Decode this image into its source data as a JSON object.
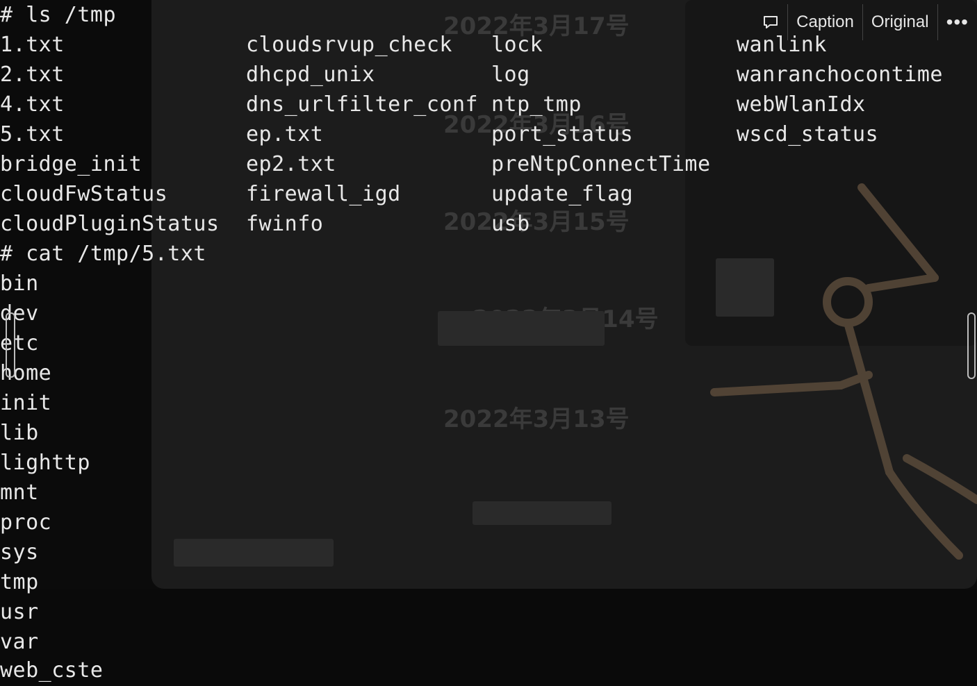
{
  "terminal": {
    "cmd1": "# ls /tmp",
    "ls_columns": [
      [
        "1.txt",
        "2.txt",
        "4.txt",
        "5.txt",
        "bridge_init",
        "cloudFwStatus",
        "cloudPluginStatus"
      ],
      [
        "cloudsrvup_check",
        "dhcpd_unix",
        "dns_urlfilter_conf",
        "ep.txt",
        "ep2.txt",
        "firewall_igd",
        "fwinfo"
      ],
      [
        "lock",
        "log",
        "ntp_tmp",
        "port_status",
        "preNtpConnectTime",
        "update_flag",
        "usb"
      ],
      [
        "wanlink",
        "wanranchocontime",
        "webWlanIdx",
        "wscd_status"
      ]
    ],
    "cmd2": "# cat /tmp/5.txt",
    "cat_output": [
      "bin",
      "dev",
      "etc",
      "home",
      "init",
      "lib",
      "lighttp",
      "mnt",
      "proc",
      "sys",
      "tmp",
      "usr",
      "var",
      "web_cste"
    ]
  },
  "toolbar": {
    "caption_label": "Caption",
    "original_label": "Original",
    "caption_icon": "speech-bubble-icon",
    "more_icon": "ellipsis-icon"
  },
  "background_text": {
    "headings": [
      "2022年3月17号",
      "2022年3月16号",
      "2022年3月15号",
      "2022年3月14号",
      "2022年3月13号"
    ]
  },
  "colors": {
    "terminal_text": "#e8e8e8",
    "background": "#0b0b0b",
    "glow": "#e6a04a"
  }
}
